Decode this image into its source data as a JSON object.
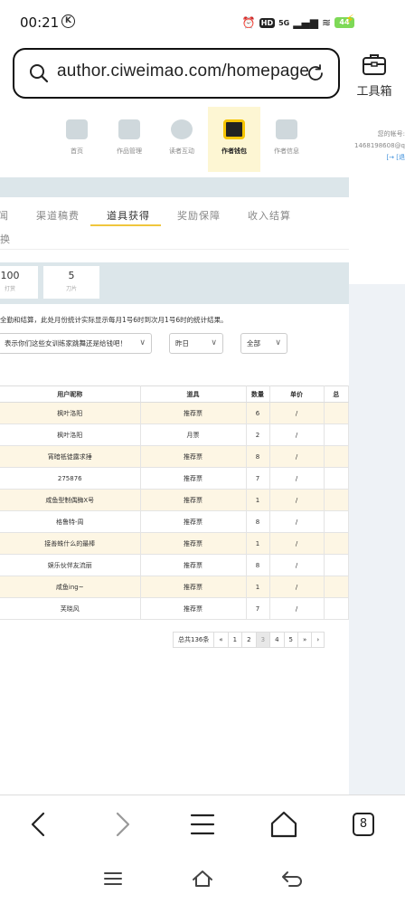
{
  "status": {
    "time": "00:21",
    "k_badge": "K",
    "hd": "HD",
    "net": "5G",
    "battery": "44"
  },
  "address": {
    "url": "author.ciweimao.com/homepage"
  },
  "toolbox": {
    "label": "工具箱"
  },
  "topnav": {
    "items": [
      {
        "label": "首页",
        "active": false
      },
      {
        "label": "作品管理",
        "active": false
      },
      {
        "label": "读者互动",
        "active": false
      },
      {
        "label": "作者钱包",
        "active": true
      },
      {
        "label": "作者信息",
        "active": false
      }
    ]
  },
  "account": {
    "line1": "您的帐号:",
    "line2": "1468198608@qq",
    "line3": "[→ [退"
  },
  "tabs": {
    "partial": "闻",
    "items": [
      "渠道稿费",
      "道具获得",
      "奖励保障",
      "收入结算"
    ],
    "active": "道具获得",
    "row2": "换"
  },
  "stats": [
    {
      "value": "100",
      "label": "打赏"
    },
    {
      "value": "5",
      "label": "刀片"
    }
  ],
  "notice": "全勤和结算，此处月份统计实际显示每月1号6时到次月1号6时的统计结果。",
  "filters": {
    "message": "表示你们这些女训练家跳舞还是给钱吧！",
    "date": "昨日",
    "type": "全部"
  },
  "table": {
    "headers": [
      "用户昵称",
      "道具",
      "数量",
      "单价",
      "总"
    ],
    "rows": [
      [
        "枫叶洛阳",
        "推荐票",
        "6",
        "/"
      ],
      [
        "枫叶洛阳",
        "月票",
        "2",
        "/"
      ],
      [
        "宵暗祇徒露求捶",
        "推荐票",
        "8",
        "/"
      ],
      [
        "275876",
        "推荐票",
        "7",
        "/"
      ],
      [
        "咸鱼型制偶酶X号",
        "推荐票",
        "1",
        "/"
      ],
      [
        "格鲁特-周",
        "推荐票",
        "8",
        "/"
      ],
      [
        "接善蛛什么的最棒",
        "推荐票",
        "1",
        "/"
      ],
      [
        "娱乐伙伴友流丽",
        "推荐票",
        "8",
        "/"
      ],
      [
        "咸鱼ing~",
        "推荐票",
        "1",
        "/"
      ],
      [
        "芙晓风",
        "推荐票",
        "7",
        "/"
      ]
    ]
  },
  "pager": {
    "total": "总共136条",
    "items": [
      "«",
      "1",
      "2",
      "3",
      "4",
      "5",
      "»",
      "›"
    ],
    "current": "3"
  },
  "browser": {
    "tab_count": "8"
  }
}
